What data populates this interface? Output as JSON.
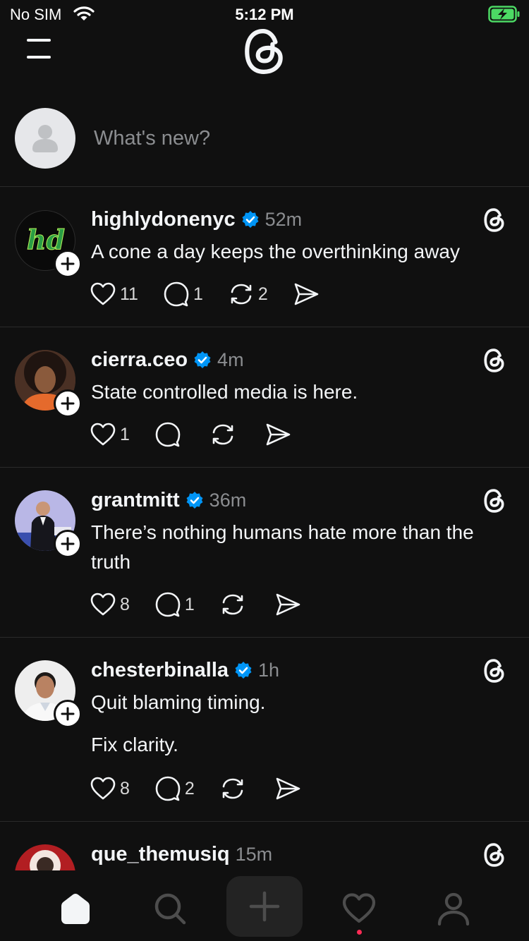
{
  "status_bar": {
    "carrier": "No SIM",
    "time": "5:12 PM"
  },
  "composer": {
    "placeholder": "What's new?"
  },
  "posts": [
    {
      "username": "highlydonenyc",
      "time": "52m",
      "text": [
        "A cone a day keeps the overthinking away"
      ],
      "likes": "11",
      "replies": "1",
      "reposts": "2",
      "avatar_text": "hd"
    },
    {
      "username": "cierra.ceo",
      "time": "4m",
      "text": [
        "State controlled media is here."
      ],
      "likes": "1",
      "replies": "",
      "reposts": ""
    },
    {
      "username": "grantmitt",
      "time": "36m",
      "text": [
        "There’s nothing humans hate more than the truth"
      ],
      "likes": "8",
      "replies": "1",
      "reposts": ""
    },
    {
      "username": "chesterbinalla",
      "time": "1h",
      "text": [
        "Quit blaming timing.",
        "Fix clarity."
      ],
      "likes": "8",
      "replies": "2",
      "reposts": ""
    },
    {
      "username": "que_themusiq",
      "time": "15m",
      "text": [],
      "likes": "",
      "replies": "",
      "reposts": ""
    }
  ],
  "colors": {
    "background": "#101010",
    "text": "#f3f5f7",
    "muted": "#8b8d90",
    "verified": "#0095f6",
    "notification_dot": "#ff2b55",
    "battery": "#4cd964"
  },
  "icons": {
    "menu": "hamburger-icon",
    "logo": "threads-logo-icon",
    "like": "heart-icon",
    "reply": "comment-bubble-icon",
    "repost": "repost-icon",
    "share": "send-icon",
    "nav": [
      "home-icon",
      "search-icon",
      "compose-plus-icon",
      "activity-heart-icon",
      "profile-icon"
    ]
  }
}
